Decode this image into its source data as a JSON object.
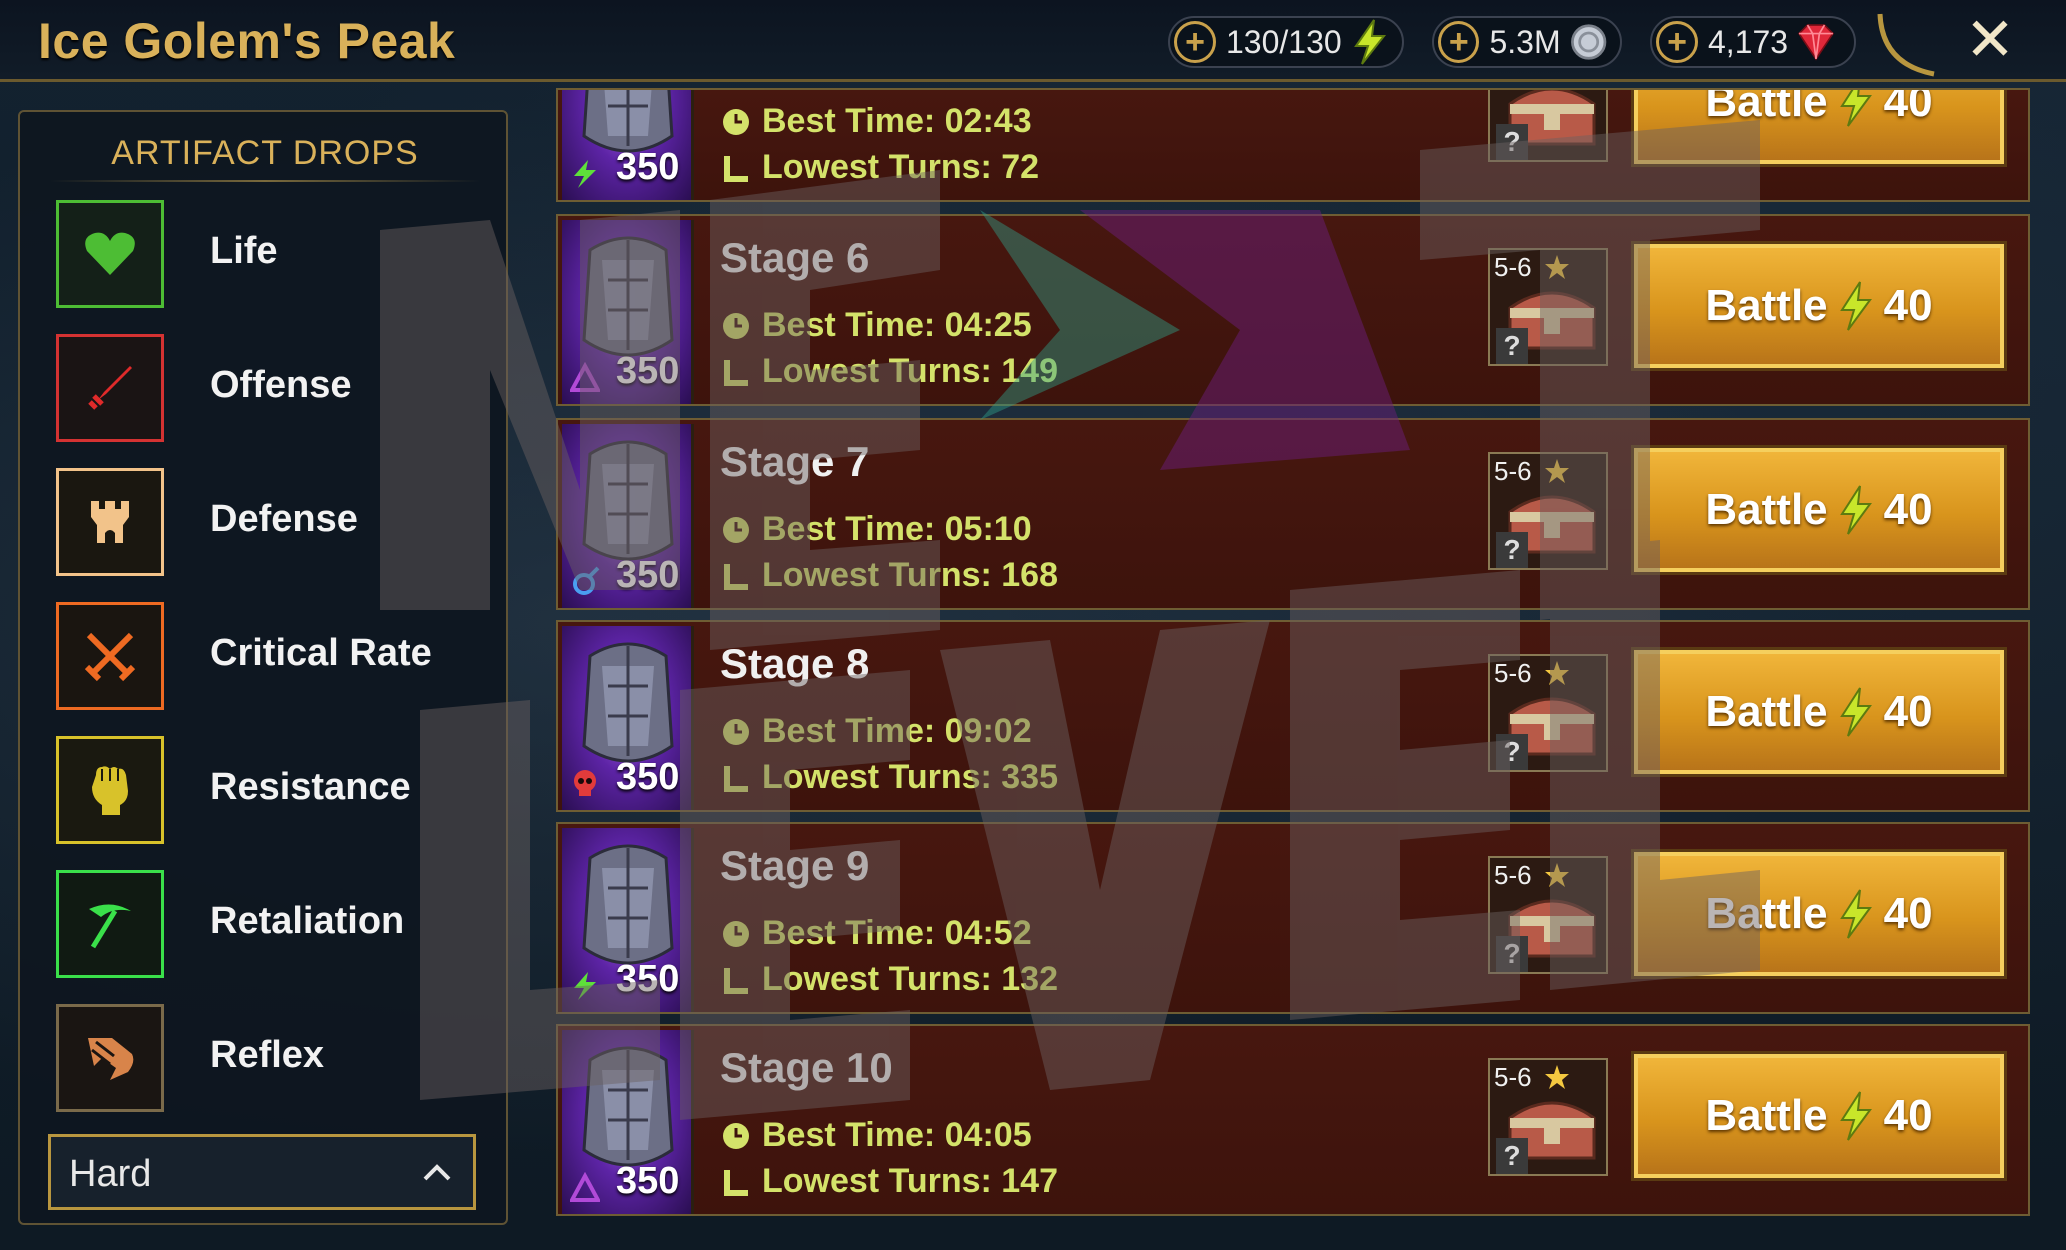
{
  "header": {
    "title": "Ice Golem's Peak",
    "energy": "130/130",
    "silver": "5.3M",
    "gems": "4,173"
  },
  "panel": {
    "title": "ARTIFACT DROPS",
    "items": [
      {
        "label": "Life",
        "icon": "heart-icon",
        "color": "#4dbd34"
      },
      {
        "label": "Offense",
        "icon": "sword-icon",
        "color": "#d43232"
      },
      {
        "label": "Defense",
        "icon": "castle-tower-icon",
        "color": "#f2c38a"
      },
      {
        "label": "Critical Rate",
        "icon": "crossed-swords-icon",
        "color": "#ee6a22"
      },
      {
        "label": "Resistance",
        "icon": "fist-icon",
        "color": "#d8c22a"
      },
      {
        "label": "Retaliation",
        "icon": "pickaxe-icon",
        "color": "#3ae04a"
      },
      {
        "label": "Reflex",
        "icon": "boot-icon",
        "color": "#d8844a"
      }
    ],
    "difficulty": "Hard"
  },
  "stages": [
    {
      "name": "",
      "best_time_label": "Best Time: 02:43",
      "turns_label": "Lowest Turns: 72",
      "power": "350",
      "affinity": "lightning-icon",
      "rank": "",
      "battle": "Battle",
      "cost": "40"
    },
    {
      "name": "Stage 6",
      "best_time_label": "Best Time: 04:25",
      "turns_label": "Lowest Turns: 149",
      "power": "350",
      "affinity": "triangle-icon",
      "rank": "5-6",
      "battle": "Battle",
      "cost": "40"
    },
    {
      "name": "Stage 7",
      "best_time_label": "Best Time: 05:10",
      "turns_label": "Lowest Turns: 168",
      "power": "350",
      "affinity": "swirl-icon",
      "rank": "5-6",
      "battle": "Battle",
      "cost": "40"
    },
    {
      "name": "Stage 8",
      "best_time_label": "Best Time: 09:02",
      "turns_label": "Lowest Turns: 335",
      "power": "350",
      "affinity": "skull-icon",
      "rank": "5-6",
      "battle": "Battle",
      "cost": "40"
    },
    {
      "name": "Stage 9",
      "best_time_label": "Best Time: 04:52",
      "turns_label": "Lowest Turns: 132",
      "power": "350",
      "affinity": "lightning-icon",
      "rank": "5-6",
      "battle": "Battle",
      "cost": "40"
    },
    {
      "name": "Stage 10",
      "best_time_label": "Best Time: 04:05",
      "turns_label": "Lowest Turns: 147",
      "power": "350",
      "affinity": "triangle-icon",
      "rank": "5-6",
      "battle": "Battle",
      "cost": "40"
    }
  ]
}
